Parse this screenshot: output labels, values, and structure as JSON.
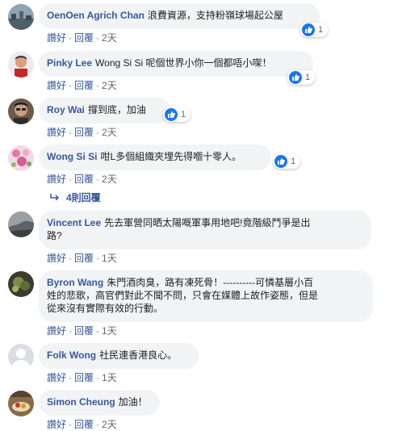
{
  "common": {
    "like": "讚好",
    "reply": "回覆",
    "sep": "·"
  },
  "comments": [
    {
      "author": "OenOen Agrich Chan",
      "text": "浪費資源，支持粉嶺球場起公屋",
      "likes": "1",
      "time": "2天"
    },
    {
      "author": "Pinky Lee",
      "text": "Wong Si Si 呢個世界小你一個都唔小㗎！",
      "likes": "1",
      "time": "2天"
    },
    {
      "author": "Roy Wai",
      "text": "撐到底，加油",
      "likes": "1",
      "time": "2天"
    },
    {
      "author": "Wong Si Si",
      "text": "咁L多個組織夾埋先得嗰十零人。",
      "likes": "1",
      "time": "2天",
      "replies": "4則回覆"
    },
    {
      "author": "Vincent Lee",
      "text_lines": [
        "先去軍營同晒太陽嘅軍事用地吧!竟階級鬥爭是出",
        "路?"
      ],
      "time": "1天"
    },
    {
      "author": "Byron Wang",
      "text_lines": [
        "朱門酒肉臭，路有凍死骨！----------可憐基層小百",
        "姓的悲歌，高官們對此不聞不問，只會在媒體上故作姿態，但是",
        "從來沒有實際有效的行動。"
      ],
      "time": "1天"
    },
    {
      "author": "Folk Wong",
      "text": "社民連香港良心。",
      "time": "1天"
    },
    {
      "author": "Simon Cheung",
      "text": "加油！",
      "time": "2天"
    }
  ],
  "colors": {
    "author": "#385898",
    "bubble": "#f2f3f5",
    "like_blue": "#1877f2",
    "meta": "#606770"
  }
}
